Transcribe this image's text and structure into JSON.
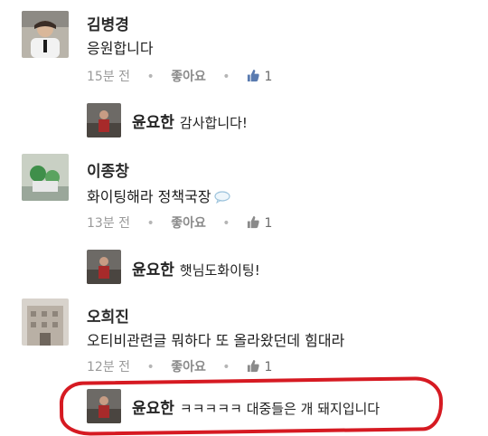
{
  "comments": [
    {
      "author": "김병경",
      "text": "응원합니다",
      "time": "15분 전",
      "like_label": "좋아요",
      "like_count": "1",
      "reply": {
        "author": "윤요한",
        "text": "감사합니다!"
      }
    },
    {
      "author": "이종창",
      "text": "화이팅해라 정책국장",
      "time": "13분 전",
      "like_label": "좋아요",
      "like_count": "1",
      "reply": {
        "author": "윤요한",
        "text": "햇님도화이팅!"
      }
    },
    {
      "author": "오희진",
      "text": "오티비관련글 뭐하다 또 올라왔던데 힘대라",
      "time": "12분 전",
      "like_label": "좋아요",
      "like_count": "1",
      "reply": {
        "author": "윤요한",
        "text": "ㅋㅋㅋㅋㅋ 대중들은 개 돼지입니다"
      }
    }
  ],
  "colors": {
    "highlight": "#d61a22",
    "meta": "#9a9a9a"
  },
  "icons": {
    "like": "thumbs-up-icon",
    "speech": "speech-bubble-icon"
  }
}
